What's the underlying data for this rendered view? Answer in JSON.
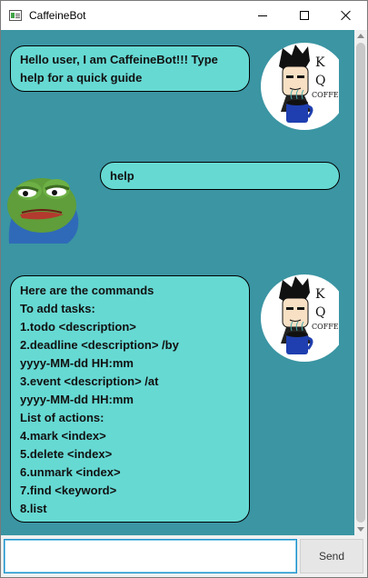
{
  "window": {
    "title": "CaffeineBot"
  },
  "messages": [
    {
      "sender": "bot",
      "text": "Hello user, I am CaffeineBot!!! Type help for a quick guide"
    },
    {
      "sender": "user",
      "text": "help"
    },
    {
      "sender": "bot",
      "lines": [
        "Here are the commands",
        "To add tasks:",
        "1.todo <description>",
        "2.deadline <description> /by",
        "yyyy-MM-dd HH:mm",
        "3.event <description> /at",
        "yyyy-MM-dd HH:mm",
        "List of actions:",
        "4.mark <index>",
        "5.delete <index>",
        "6.unmark <index>",
        "7.find <keyword>",
        "8.list"
      ]
    }
  ],
  "bot_logo": {
    "letters": [
      "K",
      "Q"
    ],
    "word": "COFFEE"
  },
  "input": {
    "value": "",
    "placeholder": ""
  },
  "send_button": {
    "label": "Send"
  },
  "colors": {
    "chat_background": "#3b95a3",
    "bubble": "#66d9d3"
  }
}
